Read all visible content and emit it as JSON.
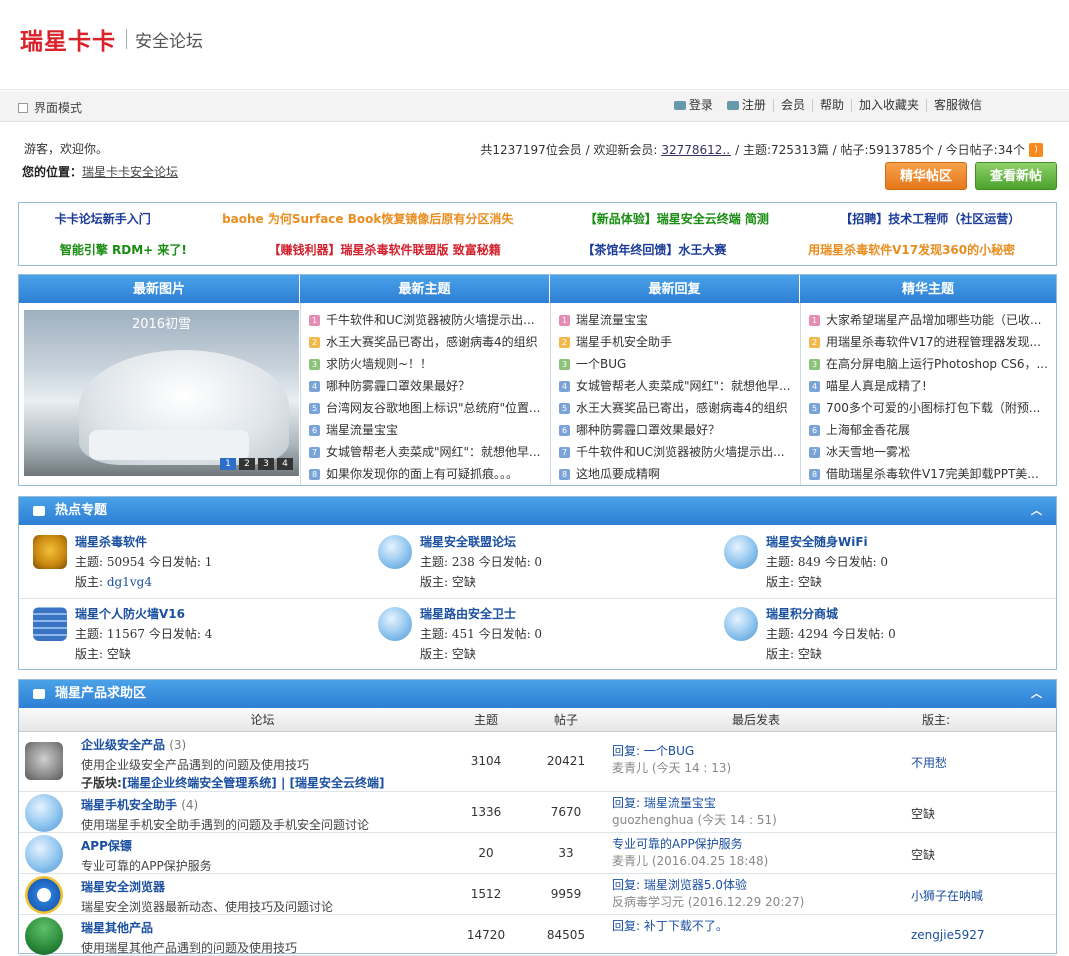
{
  "header": {
    "logo": "瑞星卡卡",
    "subtitle": "安全论坛"
  },
  "topbar": {
    "mode": "界面模式",
    "links": [
      "登录",
      "注册",
      "会员",
      "帮助",
      "加入收藏夹",
      "客服微信"
    ]
  },
  "welcome": "游客，欢迎你。",
  "position": {
    "label": "您的位置：",
    "link": "瑞星卡卡安全论坛"
  },
  "stats": {
    "prefix": "共1237197位会员 / 欢迎新会员:",
    "new_member": "32778612...",
    "suffix": "/ 主题:725313篇 / 帖子:5913785个 / 今日帖子:34个"
  },
  "buttons": {
    "digest": "精华帖区",
    "new": "查看新帖"
  },
  "announcements": [
    [
      "卡卡论坛新手入门",
      "baohe 为何Surface Book恢复镜像后原有分区消失",
      "【新品体验】瑞星安全云终端 简测",
      "【招聘】技术工程师（社区运营）"
    ],
    [
      "智能引擎 RDM+ 来了!",
      "【赚钱利器】瑞星杀毒软件联盟版 致富秘籍",
      "【茶馆年终回馈】水王大赛",
      "用瑞星杀毒软件V17发现360的小秘密"
    ]
  ],
  "latest": {
    "heads": [
      "最新图片",
      "最新主题",
      "最新回复",
      "精华主题"
    ],
    "photo_title": "2016初雪",
    "dots": [
      "1",
      "2",
      "3",
      "4"
    ],
    "new_topics": [
      "千牛软件和UC浏览器被防火墙提示出...",
      "水王大赛奖品已寄出，感谢病毒4的组织",
      "求防火墙规则~！！",
      "哪种防雾霾口罩效果最好？",
      "台湾网友谷歌地图上标识\"总统府\"位置...",
      "瑞星流量宝宝",
      "女城管帮老人卖菜成\"网红\"：就想他早...",
      "如果你发现你的面上有可疑抓痕。。。"
    ],
    "new_replies": [
      "瑞星流量宝宝",
      "瑞星手机安全助手",
      "一个BUG",
      "女城管帮老人卖菜成\"网红\"：就想他早...",
      "水王大赛奖品已寄出，感谢病毒4的组织",
      "哪种防雾霾口罩效果最好？",
      "千牛软件和UC浏览器被防火墙提示出...",
      "这地瓜要成精啊"
    ],
    "digest": [
      "大家希望瑞星产品增加哪些功能（已收...",
      "用瑞星杀毒软件V17的进程管理器发现...",
      "在高分屏电脑上运行Photoshop CS6，...",
      "喵星人真是成精了!",
      "700多个可爱的小图标打包下载（附预...",
      "上海郁金香花展",
      "冰天雪地一雾凇",
      "借助瑞星杀毒软件V17完美卸载PPT美..."
    ]
  },
  "hot": {
    "title": "热点专题",
    "items": [
      {
        "name": "瑞星杀毒软件",
        "line1": "主题: 50954  今日发帖: 1",
        "mod_label": "版主: ",
        "mod": "dg1vg4",
        "icon": "lion-shield-icon"
      },
      {
        "name": "瑞星安全联盟论坛",
        "line1": "主题: 238  今日发帖: 0",
        "mod_label": "版主: ",
        "mod": "空缺",
        "icon": "forum-bubble-icon"
      },
      {
        "name": "瑞星安全随身WiFi",
        "line1": "主题: 849  今日发帖: 0",
        "mod_label": "版主: ",
        "mod": "空缺",
        "icon": "forum-bubble-icon"
      },
      {
        "name": "瑞星个人防火墙V16",
        "line1": "主题: 11567  今日发帖: 4",
        "mod_label": "版主: ",
        "mod": "空缺",
        "icon": "firewall-icon"
      },
      {
        "name": "瑞星路由安全卫士",
        "line1": "主题: 451  今日发帖: 0",
        "mod_label": "版主: ",
        "mod": "空缺",
        "icon": "forum-bubble-icon"
      },
      {
        "name": "瑞星积分商城",
        "line1": "主题: 4294  今日发帖: 0",
        "mod_label": "版主: ",
        "mod": "空缺",
        "icon": "forum-bubble-icon"
      }
    ]
  },
  "help": {
    "title": "瑞星产品求助区",
    "cols": [
      "论坛",
      "主题",
      "帖子",
      "最后发表",
      "版主:"
    ],
    "rows": [
      {
        "name": "企业级安全产品",
        "count": "(3)",
        "desc": "使用企业级安全产品遇到的问题及使用技巧",
        "sub_label": "子版块:",
        "sub": "[瑞星企业终端安全管理系统] | [瑞星安全云终端]",
        "topics": "3104",
        "posts": "20421",
        "last": "回复: 一个BUG",
        "who": "麦青儿",
        "when": "(今天 14 : 13)",
        "mod": "不用愁",
        "icon": "lion-shield-gray-icon"
      },
      {
        "name": "瑞星手机安全助手",
        "count": "(4)",
        "desc": "使用瑞星手机安全助手遇到的问题及手机安全问题讨论",
        "topics": "1336",
        "posts": "7670",
        "last": "回复: 瑞星流量宝宝",
        "who": "guozhenghua",
        "when": "(今天 14 : 51)",
        "mod": "空缺",
        "icon": "forum-bubble-icon"
      },
      {
        "name": "APP保镖",
        "count": "",
        "desc": "专业可靠的APP保护服务",
        "topics": "20",
        "posts": "33",
        "last": "专业可靠的APP保护服务",
        "who": "麦青儿",
        "when": "(2016.04.25 18:48)",
        "mod": "空缺",
        "icon": "forum-bubble-icon"
      },
      {
        "name": "瑞星安全浏览器",
        "count": "",
        "desc": "瑞星安全浏览器最新动态、使用技巧及问题讨论",
        "topics": "1512",
        "posts": "9959",
        "last": "回复: 瑞星浏览器5.0体验",
        "who": "反病毒学习元",
        "when": "(2016.12.29 20:27)",
        "mod": "小狮子在呐喊",
        "icon": "browser-e-icon"
      },
      {
        "name": "瑞星其他产品",
        "count": "",
        "desc": "使用瑞星其他产品遇到的问题及使用技巧",
        "topics": "14720",
        "posts": "84505",
        "last": "回复: 补丁下载不了。",
        "who": "",
        "when": "",
        "mod": "zengjie5927",
        "icon": "umbrella-icon"
      }
    ]
  }
}
